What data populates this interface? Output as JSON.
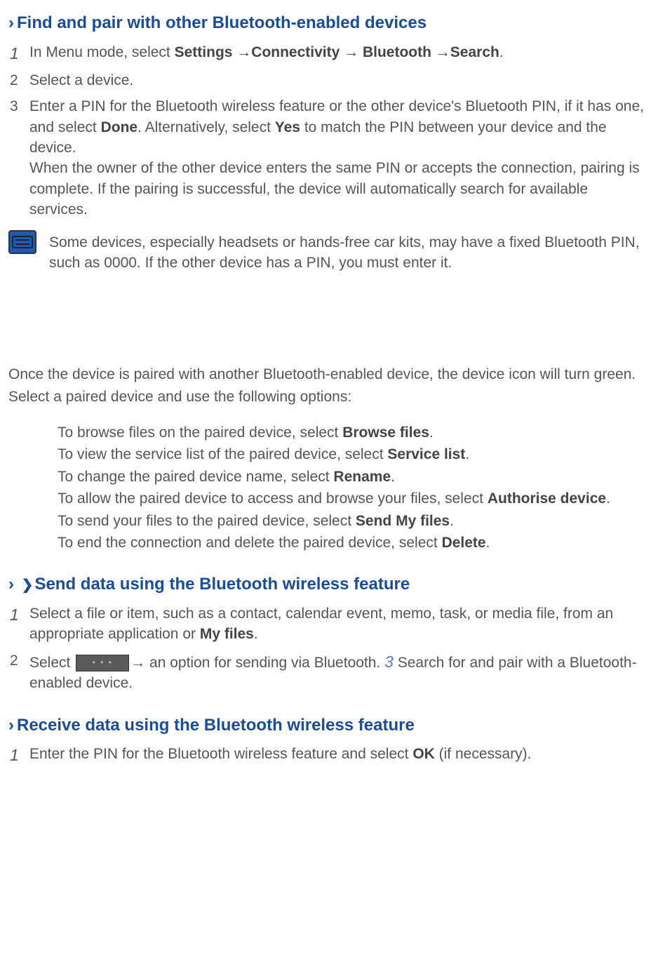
{
  "section1": {
    "heading": "Find and pair with other Bluetooth-enabled devices",
    "step1": {
      "num": "1",
      "prefix": "In Menu mode, select ",
      "bold1": "Settings →Connectivity → Bluetooth →Search",
      "suffix": "."
    },
    "step2": {
      "num": "2",
      "text": "Select a device."
    },
    "step3": {
      "num": "3",
      "p1_a": "Enter a PIN for the Bluetooth wireless feature or the other device's Bluetooth PIN, if it has one, and select ",
      "p1_b": "Done",
      "p1_c": ". Alternatively, select ",
      "p1_d": "Yes",
      "p1_e": " to match the PIN between your device and the device.",
      "p2": "When the owner of the other device enters the same PIN or accepts the connection, pairing is complete. If the pairing is successful, the device will automatically search for available services."
    },
    "note": "Some devices, especially headsets or hands-free car kits, may have a fixed Bluetooth PIN, such as 0000. If the other device has a PIN, you must enter it."
  },
  "paired": {
    "intro1": "Once the device is paired with another Bluetooth-enabled device, the device icon will turn green.",
    "intro2": "Select a paired device and use the following options:",
    "opt1a": "To browse files on the paired device, select ",
    "opt1b": "Browse files",
    "opt2a": "To view the service list of the paired device, select ",
    "opt2b": "Service list",
    "opt3a": "To change the paired device name, select ",
    "opt3b": "Rename",
    "opt4a": "To allow the paired device to access and browse your files, select ",
    "opt4b": "Authorise device",
    "opt5a": "To send your files to the paired device, select ",
    "opt5b": "Send My files",
    "opt6a": "To end the connection and delete the paired device, select ",
    "opt6b": "Delete"
  },
  "section2": {
    "heading": "Send data using the Bluetooth wireless feature",
    "step1": {
      "num": "1",
      "a": "Select a file or item, such as a contact, calendar event, memo, task, or media file, from an appropriate application or ",
      "b": "My files",
      "c": "."
    },
    "step2": {
      "num": "2",
      "a": "Select ",
      "b": "→ an option for sending via Bluetooth. ",
      "inline_num": "3",
      "c": " Search for and pair with a Bluetooth-enabled device."
    }
  },
  "section3": {
    "heading": "Receive data using the Bluetooth wireless feature",
    "step1": {
      "num": "1",
      "a": "Enter the PIN for the Bluetooth wireless feature and select ",
      "b": "OK",
      "c": " (if necessary)."
    }
  }
}
